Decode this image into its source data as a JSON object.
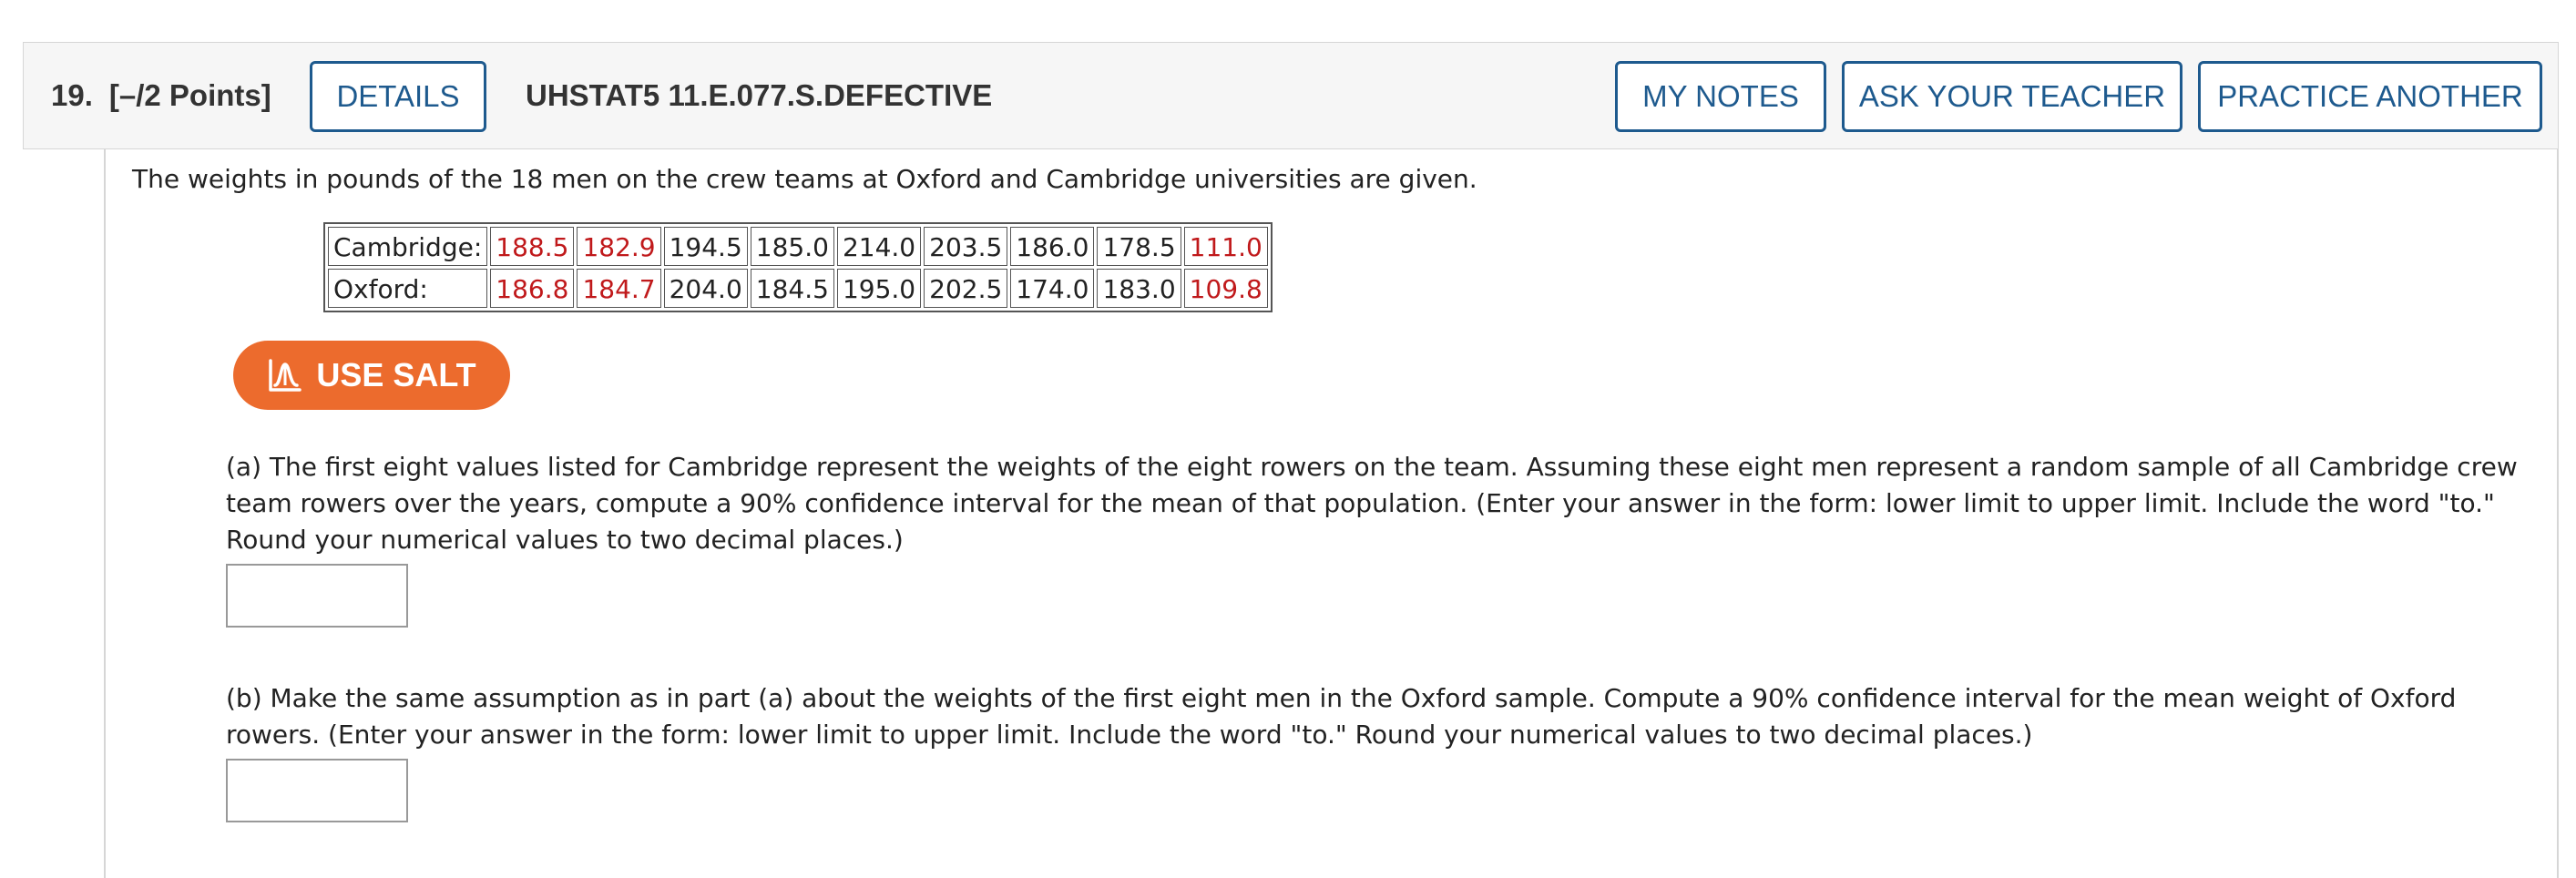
{
  "header": {
    "question_number": "19.",
    "points": "[–/2 Points]",
    "details_label": "DETAILS",
    "assignment_code": "UHSTAT5 11.E.077.S.DEFECTIVE",
    "my_notes_label": "MY NOTES",
    "ask_teacher_label": "ASK YOUR TEACHER",
    "practice_another_label": "PRACTICE ANOTHER"
  },
  "intro": "The weights in pounds of the 18 men on the crew teams at Oxford and Cambridge universities are given.",
  "table": {
    "rows": [
      {
        "label": "Cambridge:",
        "cells": [
          {
            "value": "188.5",
            "red": true
          },
          {
            "value": "182.9",
            "red": true
          },
          {
            "value": "194.5",
            "red": false
          },
          {
            "value": "185.0",
            "red": false
          },
          {
            "value": "214.0",
            "red": false
          },
          {
            "value": "203.5",
            "red": false
          },
          {
            "value": "186.0",
            "red": false
          },
          {
            "value": "178.5",
            "red": false
          },
          {
            "value": "111.0",
            "red": true
          }
        ]
      },
      {
        "label": "Oxford:",
        "cells": [
          {
            "value": "186.8",
            "red": true
          },
          {
            "value": "184.7",
            "red": true
          },
          {
            "value": "204.0",
            "red": false
          },
          {
            "value": "184.5",
            "red": false
          },
          {
            "value": "195.0",
            "red": false
          },
          {
            "value": "202.5",
            "red": false
          },
          {
            "value": "174.0",
            "red": false
          },
          {
            "value": "183.0",
            "red": false
          },
          {
            "value": "109.8",
            "red": true
          }
        ]
      }
    ]
  },
  "salt_button": {
    "label": "USE SALT",
    "icon": "salt-distribution-icon"
  },
  "colors": {
    "accent": "#1e5a8e",
    "salt_orange": "#ec6b2d",
    "highlight_red": "#c0191b"
  },
  "part_a": {
    "text": "(a) The first eight values listed for Cambridge represent the weights of the eight rowers on the team. Assuming these eight men represent a random sample of all Cambridge crew team rowers over the years, compute a 90% confidence interval for the mean of that population. (Enter your answer in the form: lower limit to upper limit. Include the word \"to.\" Round your numerical values to two decimal places.)",
    "answer": ""
  },
  "part_b": {
    "text": "(b) Make the same assumption as in part (a) about the weights of the first eight men in the Oxford sample. Compute a 90% confidence interval for the mean weight of Oxford rowers. (Enter your answer in the form: lower limit to upper limit. Include the word \"to.\" Round your numerical values to two decimal places.)",
    "answer": ""
  }
}
